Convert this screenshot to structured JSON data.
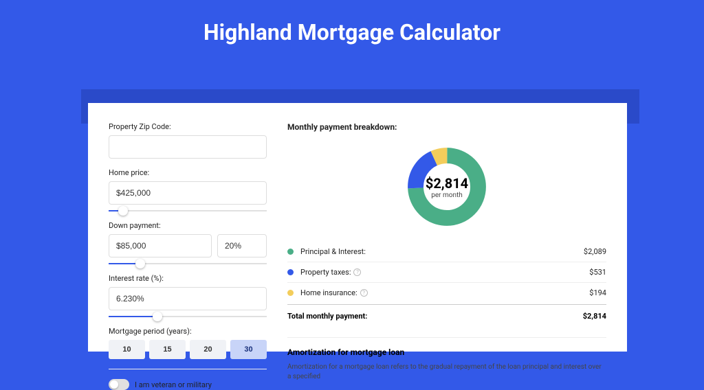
{
  "header": {
    "title": "Highland Mortgage Calculator"
  },
  "inputs": {
    "zip_label": "Property Zip Code:",
    "zip_value": "",
    "home_price_label": "Home price:",
    "home_price_value": "$425,000",
    "home_price_slider_pct": 9,
    "down_payment_label": "Down payment:",
    "down_payment_amount": "$85,000",
    "down_payment_pct": "20%",
    "down_payment_slider_pct": 20,
    "interest_label": "Interest rate (%):",
    "interest_value": "6.230%",
    "interest_slider_pct": 31,
    "period_label": "Mortgage period (years):",
    "periods": [
      "10",
      "15",
      "20",
      "30"
    ],
    "period_selected_index": 3,
    "veteran_label": "I am veteran or military"
  },
  "breakdown": {
    "title": "Monthly payment breakdown:",
    "center_amount": "$2,814",
    "center_period": "per month",
    "items": [
      {
        "label": "Principal & Interest:",
        "value": "$2,089",
        "color": "#4aae87",
        "has_info": false,
        "numeric": 2089
      },
      {
        "label": "Property taxes:",
        "value": "$531",
        "color": "#3359e8",
        "has_info": true,
        "numeric": 531
      },
      {
        "label": "Home insurance:",
        "value": "$194",
        "color": "#f3cd5b",
        "has_info": true,
        "numeric": 194
      }
    ],
    "total_label": "Total monthly payment:",
    "total_value": "$2,814"
  },
  "amortization": {
    "title": "Amortization for mortgage loan",
    "text": "Amortization for a mortgage loan refers to the gradual repayment of the loan principal and interest over a specified"
  },
  "chart_data": {
    "type": "pie",
    "title": "Monthly payment breakdown",
    "categories": [
      "Principal & Interest",
      "Property taxes",
      "Home insurance"
    ],
    "values": [
      2089,
      531,
      194
    ],
    "colors": [
      "#4aae87",
      "#3359e8",
      "#f3cd5b"
    ],
    "center_label": "$2,814 per month"
  }
}
